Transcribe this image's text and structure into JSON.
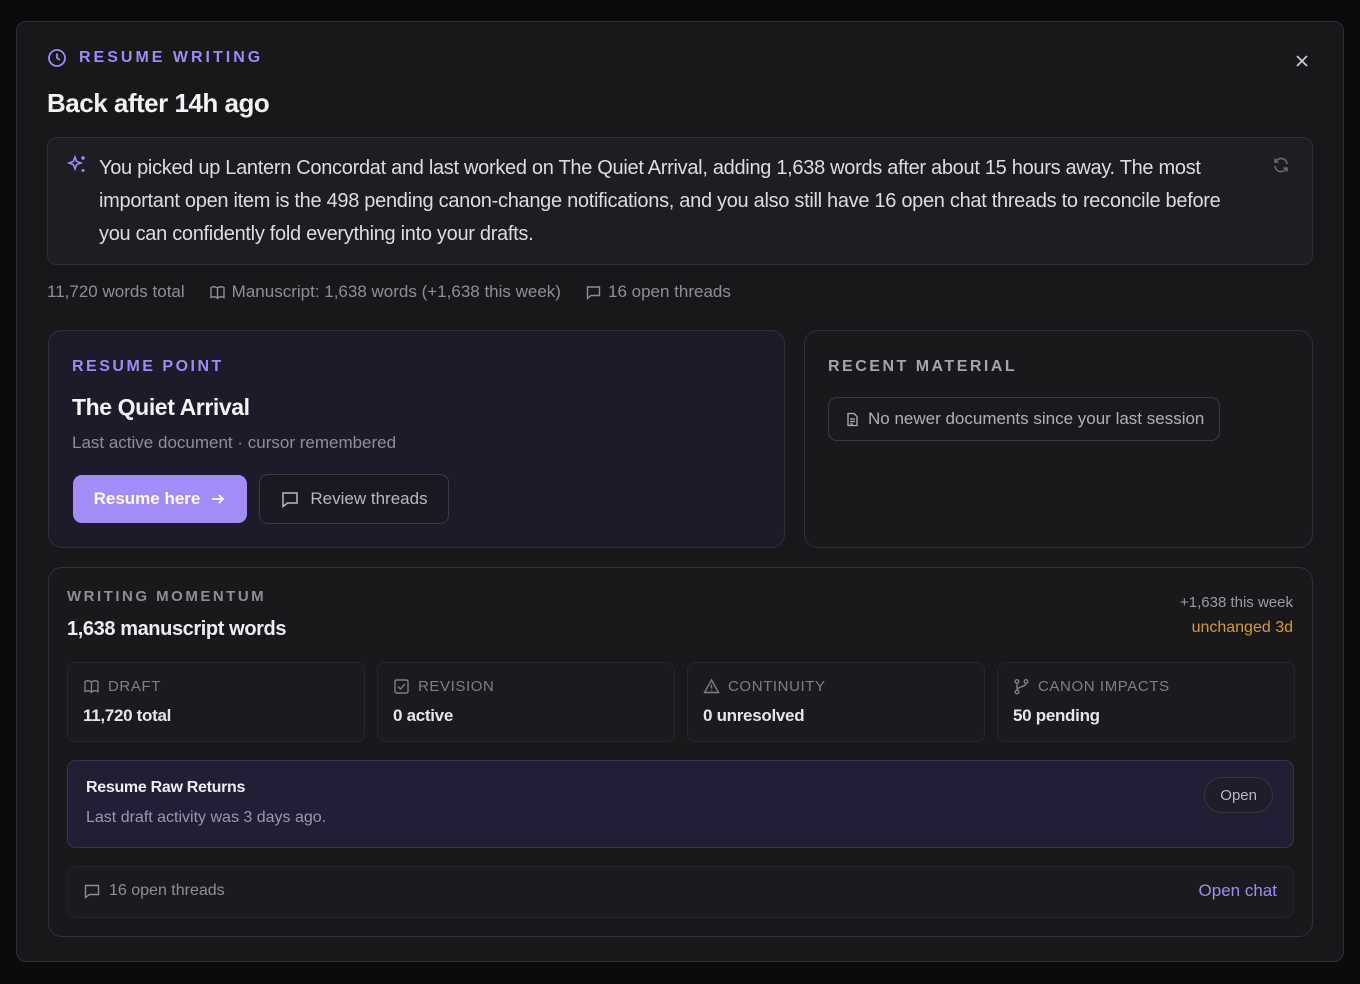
{
  "header": {
    "eyebrow": "RESUME WRITING",
    "title": "Back after 14h ago"
  },
  "summary": {
    "text": "You picked up Lantern Concordat and last worked on The Quiet Arrival, adding 1,638 words after about 15 hours away. The most important open item is the 498 pending canon-change notifications, and you also still have 16 open chat threads to reconcile before you can confidently fold everything into your drafts."
  },
  "stats": {
    "words_total": "11,720 words total",
    "manuscript": "Manuscript: 1,638 words (+1,638 this week)",
    "open_threads": "16 open threads"
  },
  "resume_point": {
    "eyebrow": "RESUME POINT",
    "title": "The Quiet Arrival",
    "subtitle": "Last active document · cursor remembered",
    "primary_label": "Resume here",
    "secondary_label": "Review threads"
  },
  "recent_material": {
    "eyebrow": "RECENT MATERIAL",
    "empty_text": "No newer documents since your last session"
  },
  "momentum": {
    "eyebrow": "WRITING MOMENTUM",
    "title": "1,638 manuscript words",
    "week": "+1,638 this week",
    "unchanged": "unchanged 3d",
    "tiles": [
      {
        "label": "DRAFT",
        "value": "11,720 total",
        "icon": "book-icon"
      },
      {
        "label": "REVISION",
        "value": "0 active",
        "icon": "checkbox-icon"
      },
      {
        "label": "CONTINUITY",
        "value": "0 unresolved",
        "icon": "warning-icon"
      },
      {
        "label": "CANON IMPACTS",
        "value": "50 pending",
        "icon": "branch-icon"
      }
    ],
    "raw": {
      "title": "Resume Raw Returns",
      "desc": "Last draft activity was 3 days ago.",
      "open_label": "Open"
    },
    "threads": {
      "label": "16 open threads",
      "action": "Open chat"
    }
  },
  "colors": {
    "accent": "#9c8cf5",
    "primary_button": "#a48cf8",
    "warning": "#d79a2b"
  }
}
